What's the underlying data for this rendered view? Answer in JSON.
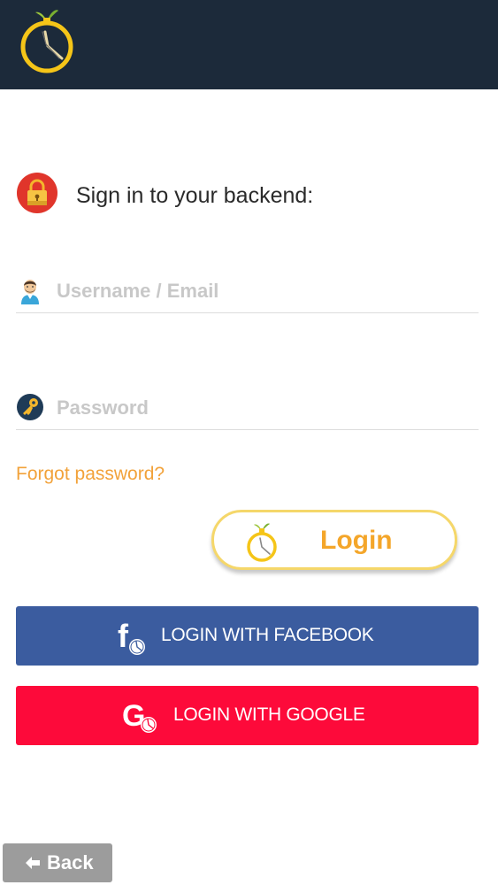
{
  "app": {
    "logo_icon": "stopwatch-logo-icon",
    "colors": {
      "header_bg": "#1c2a3a",
      "accent_yellow": "#f5c518",
      "accent_orange": "#f4a62a",
      "facebook_blue": "#3b5c9f",
      "google_red": "#fd0a3a",
      "back_gray": "#9c9c9c"
    }
  },
  "signin": {
    "heading": "Sign in to your backend:",
    "heading_icon": "padlock-icon"
  },
  "form": {
    "username": {
      "placeholder": "Username / Email",
      "value": "",
      "icon": "user-avatar-icon"
    },
    "password": {
      "placeholder": "Password",
      "value": "",
      "icon": "key-icon"
    },
    "forgot_password": "Forgot password?"
  },
  "buttons": {
    "login": {
      "label": "Login",
      "icon": "stopwatch-icon"
    },
    "facebook": {
      "label": "LOGIN WITH FACEBOOK",
      "icon": "facebook-f-icon"
    },
    "google": {
      "label": "LOGIN WITH GOOGLE",
      "icon": "google-g-icon"
    },
    "back": {
      "label": "Back",
      "icon": "arrow-left-icon"
    }
  }
}
